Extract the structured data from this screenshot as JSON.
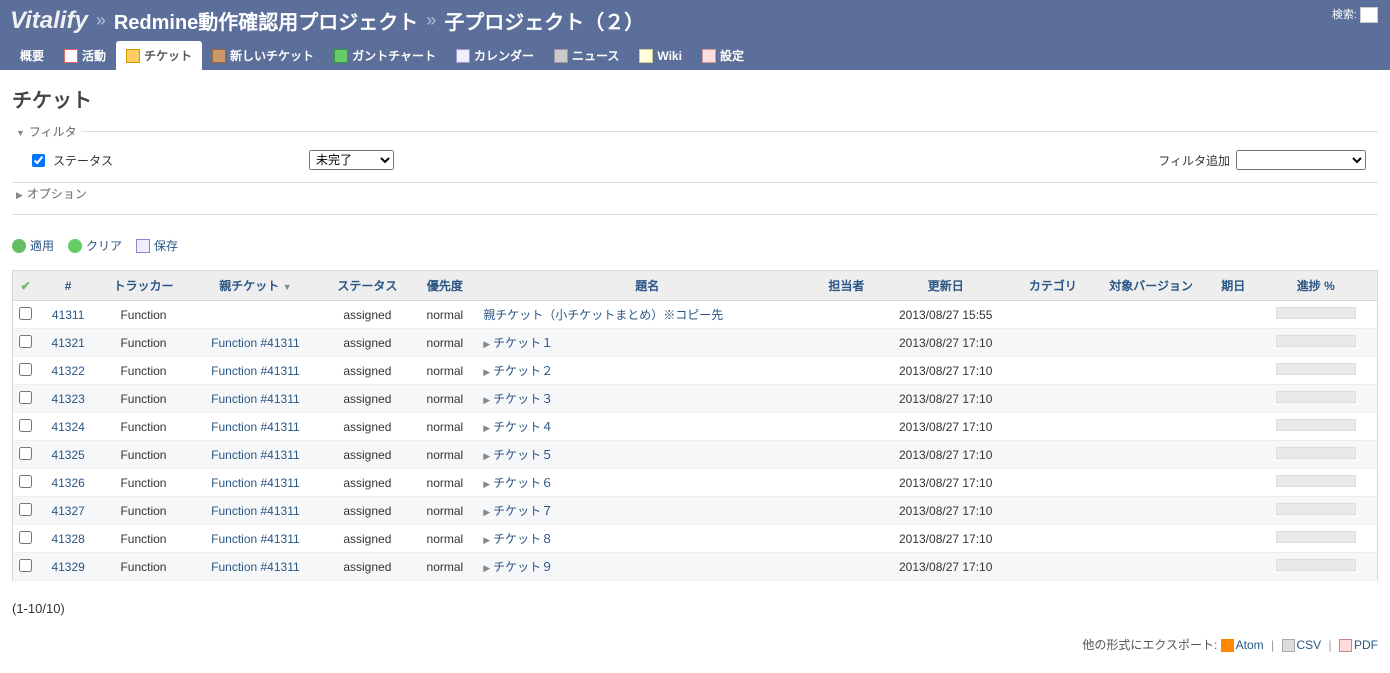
{
  "breadcrumb": {
    "brand": "Vitalify",
    "project": "Redmine動作確認用プロジェクト",
    "subproject": "子プロジェクト（２）"
  },
  "search": {
    "label": "検索:"
  },
  "tabs": {
    "overview": "概要",
    "activity": "活動",
    "tickets": "チケット",
    "new_ticket": "新しいチケット",
    "gantt": "ガントチャート",
    "calendar": "カレンダー",
    "news": "ニュース",
    "wiki": "Wiki",
    "settings": "設定"
  },
  "page_title": "チケット",
  "filters": {
    "legend": "フィルタ",
    "status_label": "ステータス",
    "status_value": "未完了",
    "add_label": "フィルタ追加",
    "add_placeholder": ""
  },
  "options": {
    "legend": "オプション"
  },
  "actions": {
    "apply": "適用",
    "clear": "クリア",
    "save": "保存"
  },
  "columns": {
    "id": "#",
    "tracker": "トラッカー",
    "parent": "親チケット",
    "status": "ステータス",
    "priority": "優先度",
    "subject": "題名",
    "assignee": "担当者",
    "updated": "更新日",
    "category": "カテゴリ",
    "version": "対象バージョン",
    "due": "期日",
    "progress": "進捗 %"
  },
  "rows": [
    {
      "id": "41311",
      "tracker": "Function",
      "parent": "",
      "status": "assigned",
      "priority": "normal",
      "subject": "親チケット（小チケットまとめ）※コピー先",
      "has_expander": false,
      "assignee": "",
      "updated": "2013/08/27 15:55",
      "category": "",
      "version": "",
      "due": ""
    },
    {
      "id": "41321",
      "tracker": "Function",
      "parent": "Function #41311",
      "status": "assigned",
      "priority": "normal",
      "subject": "チケット１",
      "has_expander": true,
      "assignee": "",
      "updated": "2013/08/27 17:10",
      "category": "",
      "version": "",
      "due": ""
    },
    {
      "id": "41322",
      "tracker": "Function",
      "parent": "Function #41311",
      "status": "assigned",
      "priority": "normal",
      "subject": "チケット２",
      "has_expander": true,
      "assignee": "",
      "updated": "2013/08/27 17:10",
      "category": "",
      "version": "",
      "due": ""
    },
    {
      "id": "41323",
      "tracker": "Function",
      "parent": "Function #41311",
      "status": "assigned",
      "priority": "normal",
      "subject": "チケット３",
      "has_expander": true,
      "assignee": "",
      "updated": "2013/08/27 17:10",
      "category": "",
      "version": "",
      "due": ""
    },
    {
      "id": "41324",
      "tracker": "Function",
      "parent": "Function #41311",
      "status": "assigned",
      "priority": "normal",
      "subject": "チケット４",
      "has_expander": true,
      "assignee": "",
      "updated": "2013/08/27 17:10",
      "category": "",
      "version": "",
      "due": ""
    },
    {
      "id": "41325",
      "tracker": "Function",
      "parent": "Function #41311",
      "status": "assigned",
      "priority": "normal",
      "subject": "チケット５",
      "has_expander": true,
      "assignee": "",
      "updated": "2013/08/27 17:10",
      "category": "",
      "version": "",
      "due": ""
    },
    {
      "id": "41326",
      "tracker": "Function",
      "parent": "Function #41311",
      "status": "assigned",
      "priority": "normal",
      "subject": "チケット６",
      "has_expander": true,
      "assignee": "",
      "updated": "2013/08/27 17:10",
      "category": "",
      "version": "",
      "due": ""
    },
    {
      "id": "41327",
      "tracker": "Function",
      "parent": "Function #41311",
      "status": "assigned",
      "priority": "normal",
      "subject": "チケット７",
      "has_expander": true,
      "assignee": "",
      "updated": "2013/08/27 17:10",
      "category": "",
      "version": "",
      "due": ""
    },
    {
      "id": "41328",
      "tracker": "Function",
      "parent": "Function #41311",
      "status": "assigned",
      "priority": "normal",
      "subject": "チケット８",
      "has_expander": true,
      "assignee": "",
      "updated": "2013/08/27 17:10",
      "category": "",
      "version": "",
      "due": ""
    },
    {
      "id": "41329",
      "tracker": "Function",
      "parent": "Function #41311",
      "status": "assigned",
      "priority": "normal",
      "subject": "チケット９",
      "has_expander": true,
      "assignee": "",
      "updated": "2013/08/27 17:10",
      "category": "",
      "version": "",
      "due": ""
    }
  ],
  "pagination": "(1-10/10)",
  "export": {
    "label": "他の形式にエクスポート:",
    "atom": "Atom",
    "csv": "CSV",
    "pdf": "PDF"
  }
}
